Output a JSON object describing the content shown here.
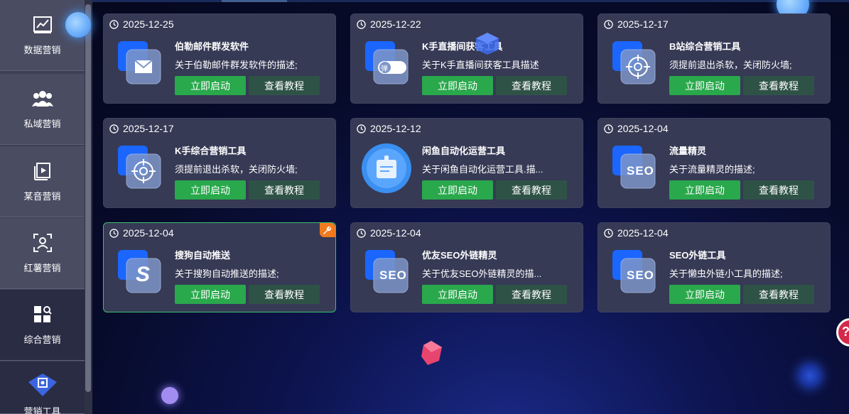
{
  "sidebar": {
    "items": [
      {
        "label": "数据营销",
        "icon": "chart-line-icon"
      },
      {
        "label": "私域营销",
        "icon": "users-icon"
      },
      {
        "label": "某音营销",
        "icon": "video-play-icon"
      },
      {
        "label": "红薯营销",
        "icon": "face-scan-icon"
      },
      {
        "label": "综合营销",
        "icon": "grid-search-icon"
      },
      {
        "label": "营销工具",
        "icon": "tools-cube-icon"
      }
    ]
  },
  "cards": [
    {
      "date": "2025-12-25",
      "title": "伯勒邮件群发软件",
      "desc": "关于伯勒邮件群发软件的描述;",
      "icon": "mail-icon"
    },
    {
      "date": "2025-12-22",
      "title": "K手直播间获客工具",
      "desc": "关于K手直播间获客工具描述",
      "icon": "danmu-toggle-icon",
      "icon_text": "弹"
    },
    {
      "date": "2025-12-17",
      "title": "B站综合营销工具",
      "desc": "须提前退出杀软，关闭防火墙;",
      "icon": "crosshair-icon"
    },
    {
      "date": "2025-12-17",
      "title": "K手综合营销工具",
      "desc": "须提前退出杀软，关闭防火墙;",
      "icon": "crosshair-icon"
    },
    {
      "date": "2025-12-12",
      "title": "闲鱼自动化运营工具",
      "desc": "关于闲鱼自动化运营工具.描...",
      "icon": "badge-card-icon"
    },
    {
      "date": "2025-12-04",
      "title": "流量精灵",
      "desc": "关于流量精灵的描述;",
      "icon": "seo-icon",
      "icon_text": "SEO"
    },
    {
      "date": "2025-12-04",
      "title": "搜狗自动推送",
      "desc": "关于搜狗自动推送的描述;",
      "icon": "sogou-s-icon",
      "icon_text": "S",
      "selected": true
    },
    {
      "date": "2025-12-04",
      "title": "优友SEO外链精灵",
      "desc": "关于优友SEO外链精灵的描...",
      "icon": "seo-icon",
      "icon_text": "SEO"
    },
    {
      "date": "2025-12-04",
      "title": "SEO外链工具",
      "desc": "关于懒虫外链小工具的描述;",
      "icon": "seo-icon",
      "icon_text": "SEO"
    }
  ],
  "buttons": {
    "start": "立即启动",
    "guide": "查看教程"
  },
  "help_label": "?",
  "colors": {
    "start_button": "#29a84c",
    "guide_button": "#2f5247",
    "card_bg": "#363a55",
    "selected_border": "#39c06b",
    "sidebar_bg": "#4a4c62"
  }
}
